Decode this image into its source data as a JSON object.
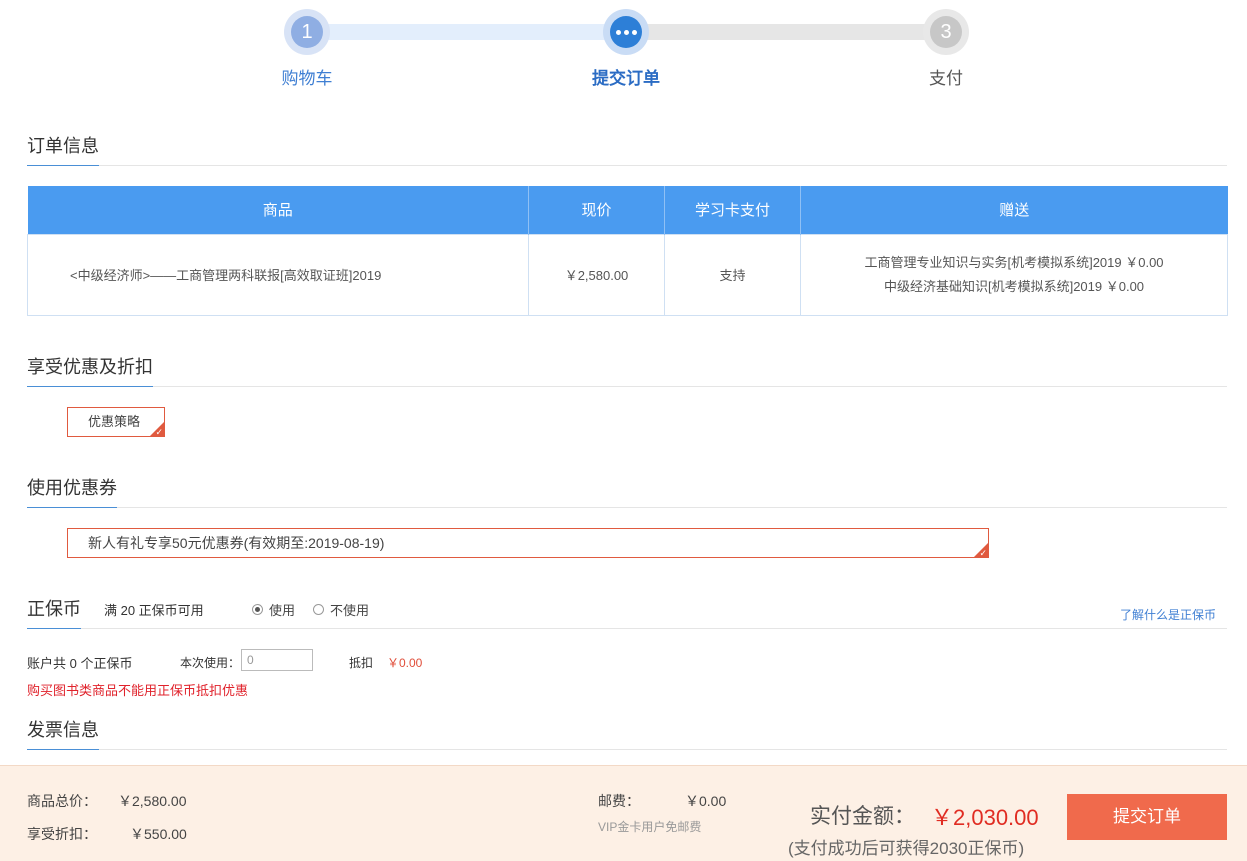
{
  "steps": [
    {
      "num": "1",
      "label": "购物车"
    },
    {
      "num": "",
      "label": "提交订单"
    },
    {
      "num": "3",
      "label": "支付"
    }
  ],
  "sections": {
    "order_info": "订单信息",
    "discount": "享受优惠及折扣",
    "coupon": "使用优惠券",
    "coins": "正保币",
    "invoice": "发票信息"
  },
  "order_table": {
    "headers": [
      "商品",
      "现价",
      "学习卡支付",
      "赠送"
    ],
    "row": {
      "product": "<中级经济师>——工商管理两科联报[高效取证班]2019",
      "price": "￥2,580.00",
      "card_pay": "支持",
      "gifts": [
        "工商管理专业知识与实务[机考模拟系统]2019 ￥0.00",
        "中级经济基础知识[机考模拟系统]2019 ￥0.00"
      ]
    }
  },
  "discount": {
    "option": "优惠策略"
  },
  "coupon": {
    "option": "新人有礼专享50元优惠券(有效期至:2019-08-19)"
  },
  "coins": {
    "condition": "满 20 正保币可用",
    "use_label": "使用",
    "not_use_label": "不使用",
    "help_link": "了解什么是正保币",
    "balance_text": "账户共 0 个正保币",
    "use_amount_label": "本次使用：",
    "use_amount_value": "0",
    "deduct_label": "抵扣",
    "deduct_value": "￥0.00",
    "warning": "购买图书类商品不能用正保币抵扣优惠"
  },
  "summary": {
    "total_label": "商品总价：",
    "total_value": "￥2,580.00",
    "discount_label": "享受折扣：",
    "discount_value": "￥550.00",
    "shipping_label": "邮费：",
    "shipping_value": "￥0.00",
    "shipping_hint": "VIP金卡用户免邮费",
    "pay_label": "实付金额：",
    "pay_value": "￥2,030.00",
    "pay_note": "(支付成功后可获得2030正保币)",
    "submit_label": "提交订单"
  },
  "colors": {
    "accent_blue": "#4a9bf0",
    "submit_orange": "#f06a4c",
    "price_red": "#e02c22"
  }
}
